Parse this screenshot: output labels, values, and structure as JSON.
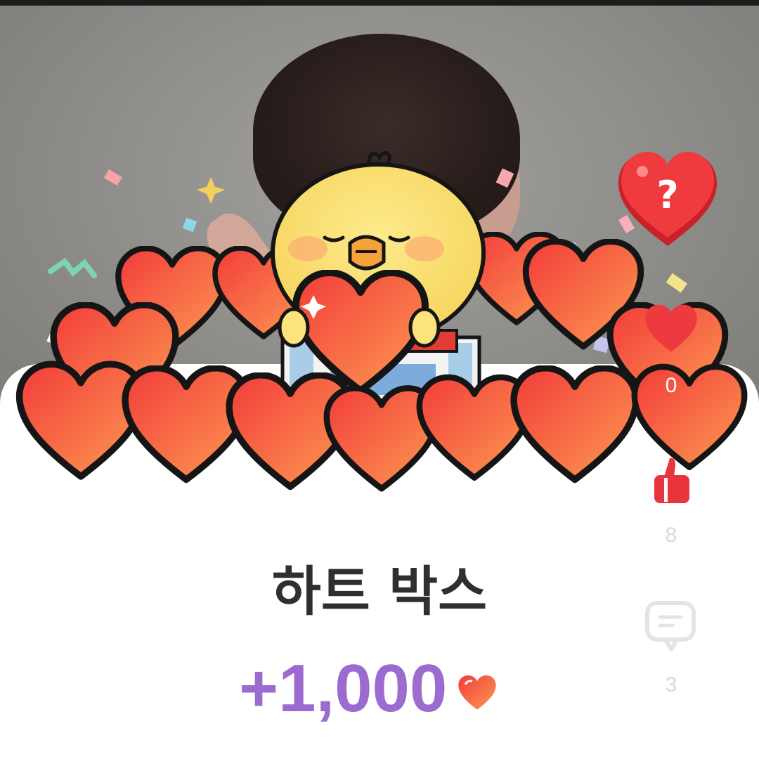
{
  "popup": {
    "title": "하트 박스",
    "reward_amount": "+1,000",
    "reward_icon": "heart-icon"
  },
  "side_actions": {
    "mystery": {
      "icon": "question-heart-icon",
      "label": "?"
    },
    "like": {
      "icon": "heart-icon",
      "count": "0"
    },
    "thumbs": {
      "icon": "thumbs-up-icon",
      "count": "8"
    },
    "comment": {
      "icon": "comment-icon",
      "count": "3"
    }
  },
  "colors": {
    "heart_red": "#f2443f",
    "heart_orange": "#fb8a4a",
    "reward_purple": "#9b6bd0",
    "title_text": "#2f2f2f",
    "chick_yellow": "#f9e173"
  }
}
